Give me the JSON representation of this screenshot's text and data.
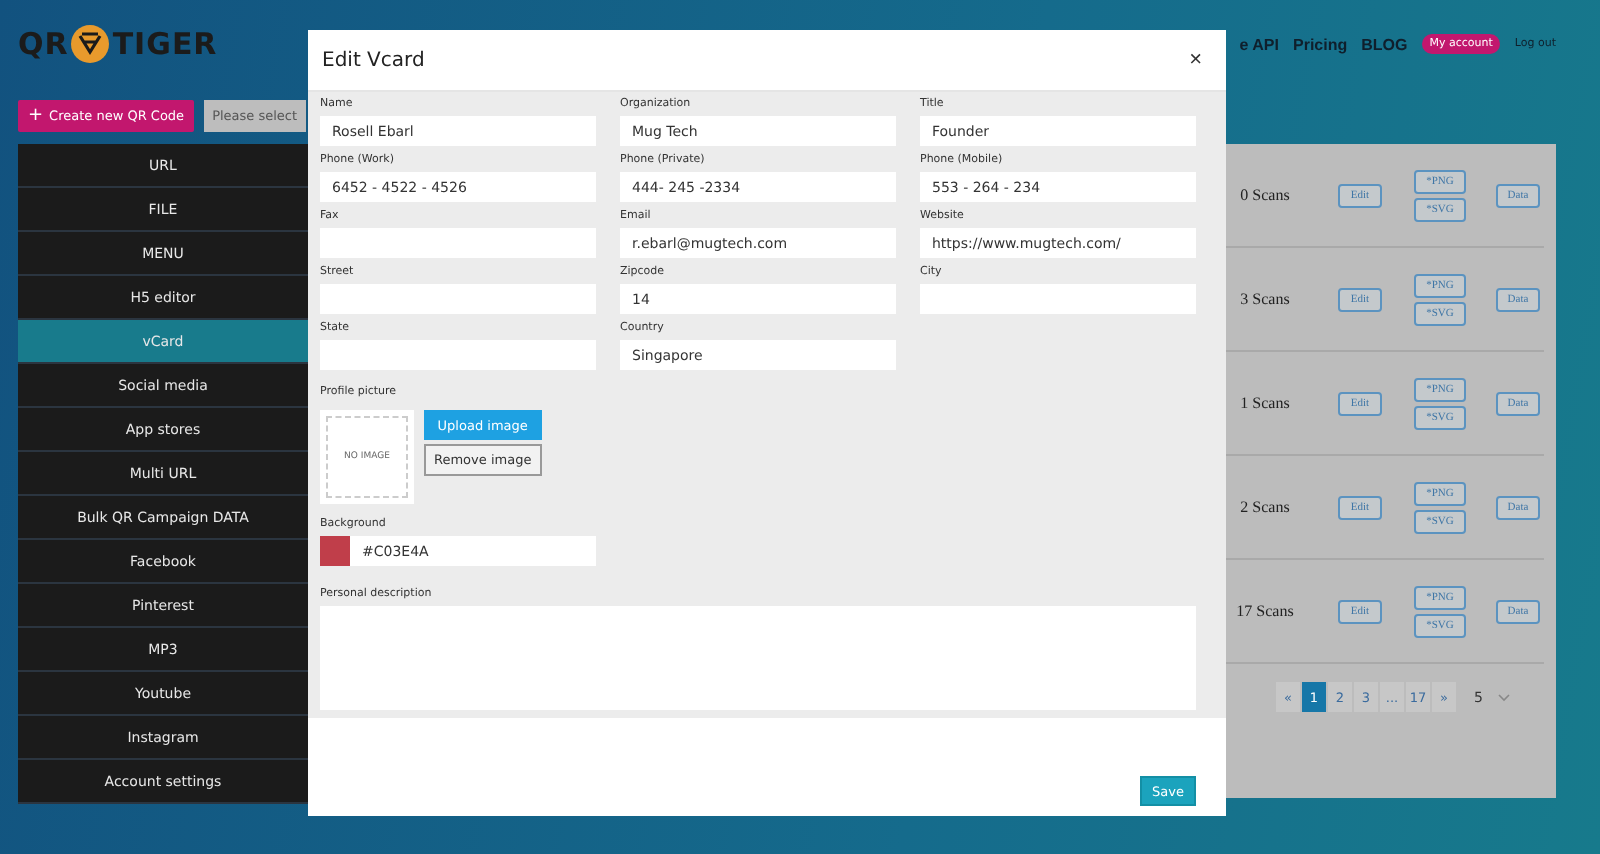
{
  "logo": {
    "left": "QR",
    "right": "TIGER"
  },
  "nav": {
    "items": [
      "e API",
      "Pricing",
      "BLOG"
    ],
    "account": "My account",
    "logout": "Log out"
  },
  "toolbar": {
    "create_icon": "+",
    "create": "Create new QR Code",
    "select": "Please select"
  },
  "sidebar": {
    "items": [
      {
        "label": "URL",
        "selected": false
      },
      {
        "label": "FILE",
        "selected": false
      },
      {
        "label": "MENU",
        "selected": false
      },
      {
        "label": "H5 editor",
        "selected": false
      },
      {
        "label": "vCard",
        "selected": true
      },
      {
        "label": "Social media",
        "selected": false
      },
      {
        "label": "App stores",
        "selected": false
      },
      {
        "label": "Multi URL",
        "selected": false
      },
      {
        "label": "Bulk QR Campaign DATA",
        "selected": false
      },
      {
        "label": "Facebook",
        "selected": false
      },
      {
        "label": "Pinterest",
        "selected": false
      },
      {
        "label": "MP3",
        "selected": false
      },
      {
        "label": "Youtube",
        "selected": false
      },
      {
        "label": "Instagram",
        "selected": false
      },
      {
        "label": "Account settings",
        "selected": false
      }
    ]
  },
  "table": {
    "rows": [
      {
        "scans": "0 Scans",
        "edit": "Edit",
        "png": "*PNG",
        "svg": "*SVG",
        "data": "Data"
      },
      {
        "scans": "3 Scans",
        "edit": "Edit",
        "png": "*PNG",
        "svg": "*SVG",
        "data": "Data"
      },
      {
        "scans": "1 Scans",
        "edit": "Edit",
        "png": "*PNG",
        "svg": "*SVG",
        "data": "Data"
      },
      {
        "scans": "2 Scans",
        "edit": "Edit",
        "png": "*PNG",
        "svg": "*SVG",
        "data": "Data"
      },
      {
        "scans": "17 Scans",
        "edit": "Edit",
        "png": "*PNG",
        "svg": "*SVG",
        "data": "Data"
      }
    ],
    "pagination": [
      {
        "label": "«",
        "selected": false
      },
      {
        "label": "1",
        "selected": true
      },
      {
        "label": "2",
        "selected": false
      },
      {
        "label": "3",
        "selected": false
      },
      {
        "label": "...",
        "selected": false
      },
      {
        "label": "17",
        "selected": false
      },
      {
        "label": "»",
        "selected": false
      }
    ],
    "page_size": "5"
  },
  "modal": {
    "title": "Edit Vcard",
    "close": "×",
    "fields": [
      {
        "label": "Name",
        "value": "Rosell Ebarl"
      },
      {
        "label": "Organization",
        "value": "Mug Tech"
      },
      {
        "label": "Title",
        "value": "Founder"
      },
      {
        "label": "Phone (Work)",
        "value": "6452 - 4522 - 4526"
      },
      {
        "label": "Phone (Private)",
        "value": "444- 245 -2334"
      },
      {
        "label": "Phone (Mobile)",
        "value": "553 - 264 - 234"
      },
      {
        "label": "Fax"
      },
      {
        "label": "Email",
        "value": "r.ebarl@mugtech.com"
      },
      {
        "label": "Website",
        "value": "https://www.mugtech.com/"
      },
      {
        "label": "Street"
      },
      {
        "label": "Zipcode",
        "value": "14"
      },
      {
        "label": "City"
      },
      {
        "label": "State"
      },
      {
        "label": "Country",
        "value": "Singapore"
      }
    ],
    "profile": {
      "label": "Profile picture",
      "placeholder": "NO IMAGE",
      "upload": "Upload image",
      "remove": "Remove image"
    },
    "background": {
      "label": "Background",
      "value": "#C03E4A"
    },
    "description": {
      "label": "Personal description"
    },
    "save": "Save"
  }
}
